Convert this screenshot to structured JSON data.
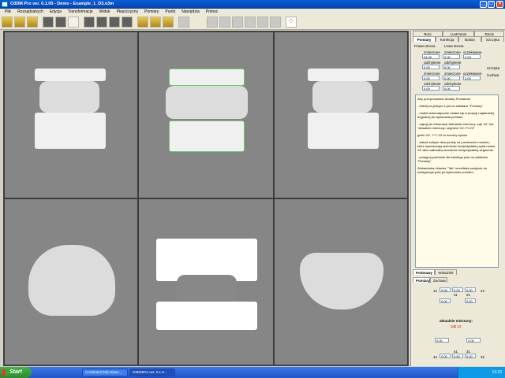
{
  "window": {
    "title": "O3DM Pro ver. 0.1.00 - Demo - Example_1_D3.o3m"
  },
  "menu": [
    "Plik",
    "Rozsądzanych",
    "Edycja",
    "Transformacje",
    "Widok",
    "Płaszczyzny",
    "Pomiary",
    "Punkt",
    "Narzędzia",
    "Pomoc"
  ],
  "panel": {
    "top_tabs": [
      "Boni",
      "Lustrzanie",
      "Tarcie",
      "Pomiary",
      "Korekcja",
      "Bolton",
      "Szczęka"
    ],
    "section_labels": {
      "left": "Prawa strona",
      "right": "Lewa strona"
    },
    "col_headers": [
      "zmierzone",
      "zmierzone",
      "oczekiwane"
    ],
    "fields_a": [
      "24.00",
      "0.00",
      "0.00"
    ],
    "sub_label": "odchylenie",
    "fields_b": [
      "0.00",
      "0.00"
    ],
    "side_labels": [
      "szczęka",
      "żuchwa"
    ],
    "fields_c": [
      "0.00",
      "0.00",
      "0.00"
    ],
    "fields_d": [
      "0.00",
      "0.00"
    ],
    "instructions": [
      "Aby przeprowadzić analizę Pomiarów:",
      "- Kliknij na jednym z pól na zakładce \"Pomiary\"",
      "- model automatycznie ustawi się w pozycji najbardziej dogodnej do wykonania pomiaru",
      "- zajrzyj do informacji \"aktualnie mierzony: ząb XX\" lub \"aktualnie mierzony: segment XX-YY-ZZ\"",
      "gdzie XX, YY i ZZ to numery zębów",
      "- wskaż kolejne dwa punkty na powierzchni modelu, które wyznaczają szerokość mezjodystalną zęba numer XX albo całkowitą szerokość mezjodystalną segmentu",
      "- postępuj podobnie dla każdego pola na zakładce \"Pomiary\"",
      "Wskazówka: klawisz \"Tab\" umożliwia przejście do następnego pola po wykonaniu pomiaru."
    ],
    "bottom_tabs": [
      "Podstawy",
      "Wskaźnik"
    ],
    "sub_tabs": [
      "Pomiary",
      "Żuchwa"
    ],
    "measure_label": "aktualnie mierzony:",
    "measure_value": "ząb 12",
    "grid_top": [
      "12",
      "0.00",
      "0.00",
      "0.00",
      "22"
    ],
    "grid_top_nums": [
      "11",
      "21"
    ],
    "grid_bottom": [
      "42",
      "0.00",
      "0.00",
      "0.00",
      "32"
    ],
    "grid_bottom_nums": [
      "41",
      "31"
    ],
    "grid_mid": [
      "0.00",
      "0.00",
      "0.00",
      "0.00"
    ]
  },
  "taskbar": {
    "start": "Start",
    "tasks": [
      "ComEnter(TM) Glass...",
      "O3DMPro ver. 0.1.0..."
    ],
    "clock": "14:23"
  }
}
